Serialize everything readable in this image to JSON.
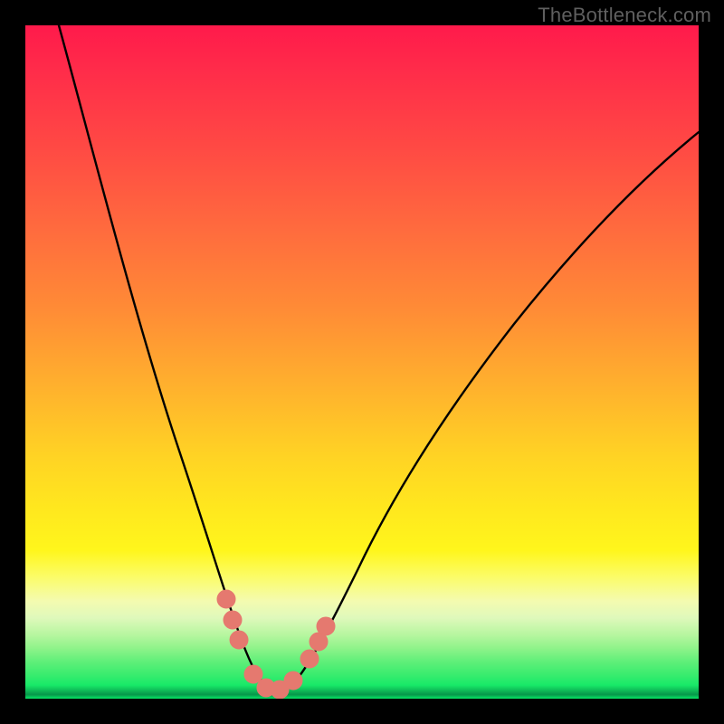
{
  "watermark": {
    "text": "TheBottleneck.com"
  },
  "chart_data": {
    "type": "line",
    "title": "",
    "xlabel": "",
    "ylabel": "",
    "xlim": [
      0,
      100
    ],
    "ylim": [
      0,
      100
    ],
    "grid": false,
    "legend": false,
    "series": [
      {
        "name": "bottleneck-curve",
        "x": [
          5,
          8,
          11,
          14,
          17,
          20,
          23,
          26,
          29,
          30.5,
          32,
          33.5,
          35,
          36.5,
          38,
          41,
          45,
          50,
          56,
          63,
          71,
          80,
          90,
          100
        ],
        "y": [
          100,
          90,
          80,
          70,
          60,
          50,
          40,
          30,
          20,
          14,
          9,
          5,
          2.5,
          1.3,
          1.3,
          2.5,
          6,
          13,
          22,
          32,
          43,
          54,
          65,
          76
        ]
      }
    ],
    "markers": {
      "name": "highlight-dots",
      "points": [
        {
          "x": 29.0,
          "y": 15.5
        },
        {
          "x": 30.0,
          "y": 12.0
        },
        {
          "x": 31.0,
          "y": 9.0
        },
        {
          "x": 33.5,
          "y": 2.7
        },
        {
          "x": 35.5,
          "y": 1.3
        },
        {
          "x": 37.5,
          "y": 1.3
        },
        {
          "x": 39.5,
          "y": 2.7
        },
        {
          "x": 41.5,
          "y": 5.5
        },
        {
          "x": 43.0,
          "y": 8.5
        },
        {
          "x": 44.0,
          "y": 11.0
        }
      ],
      "color": "#e5796f",
      "radius_px": 10
    },
    "background_gradient": {
      "top": "#ff1a4b",
      "mid": "#ffd324",
      "low": "#fff61c",
      "bottom": "#18e968"
    }
  }
}
